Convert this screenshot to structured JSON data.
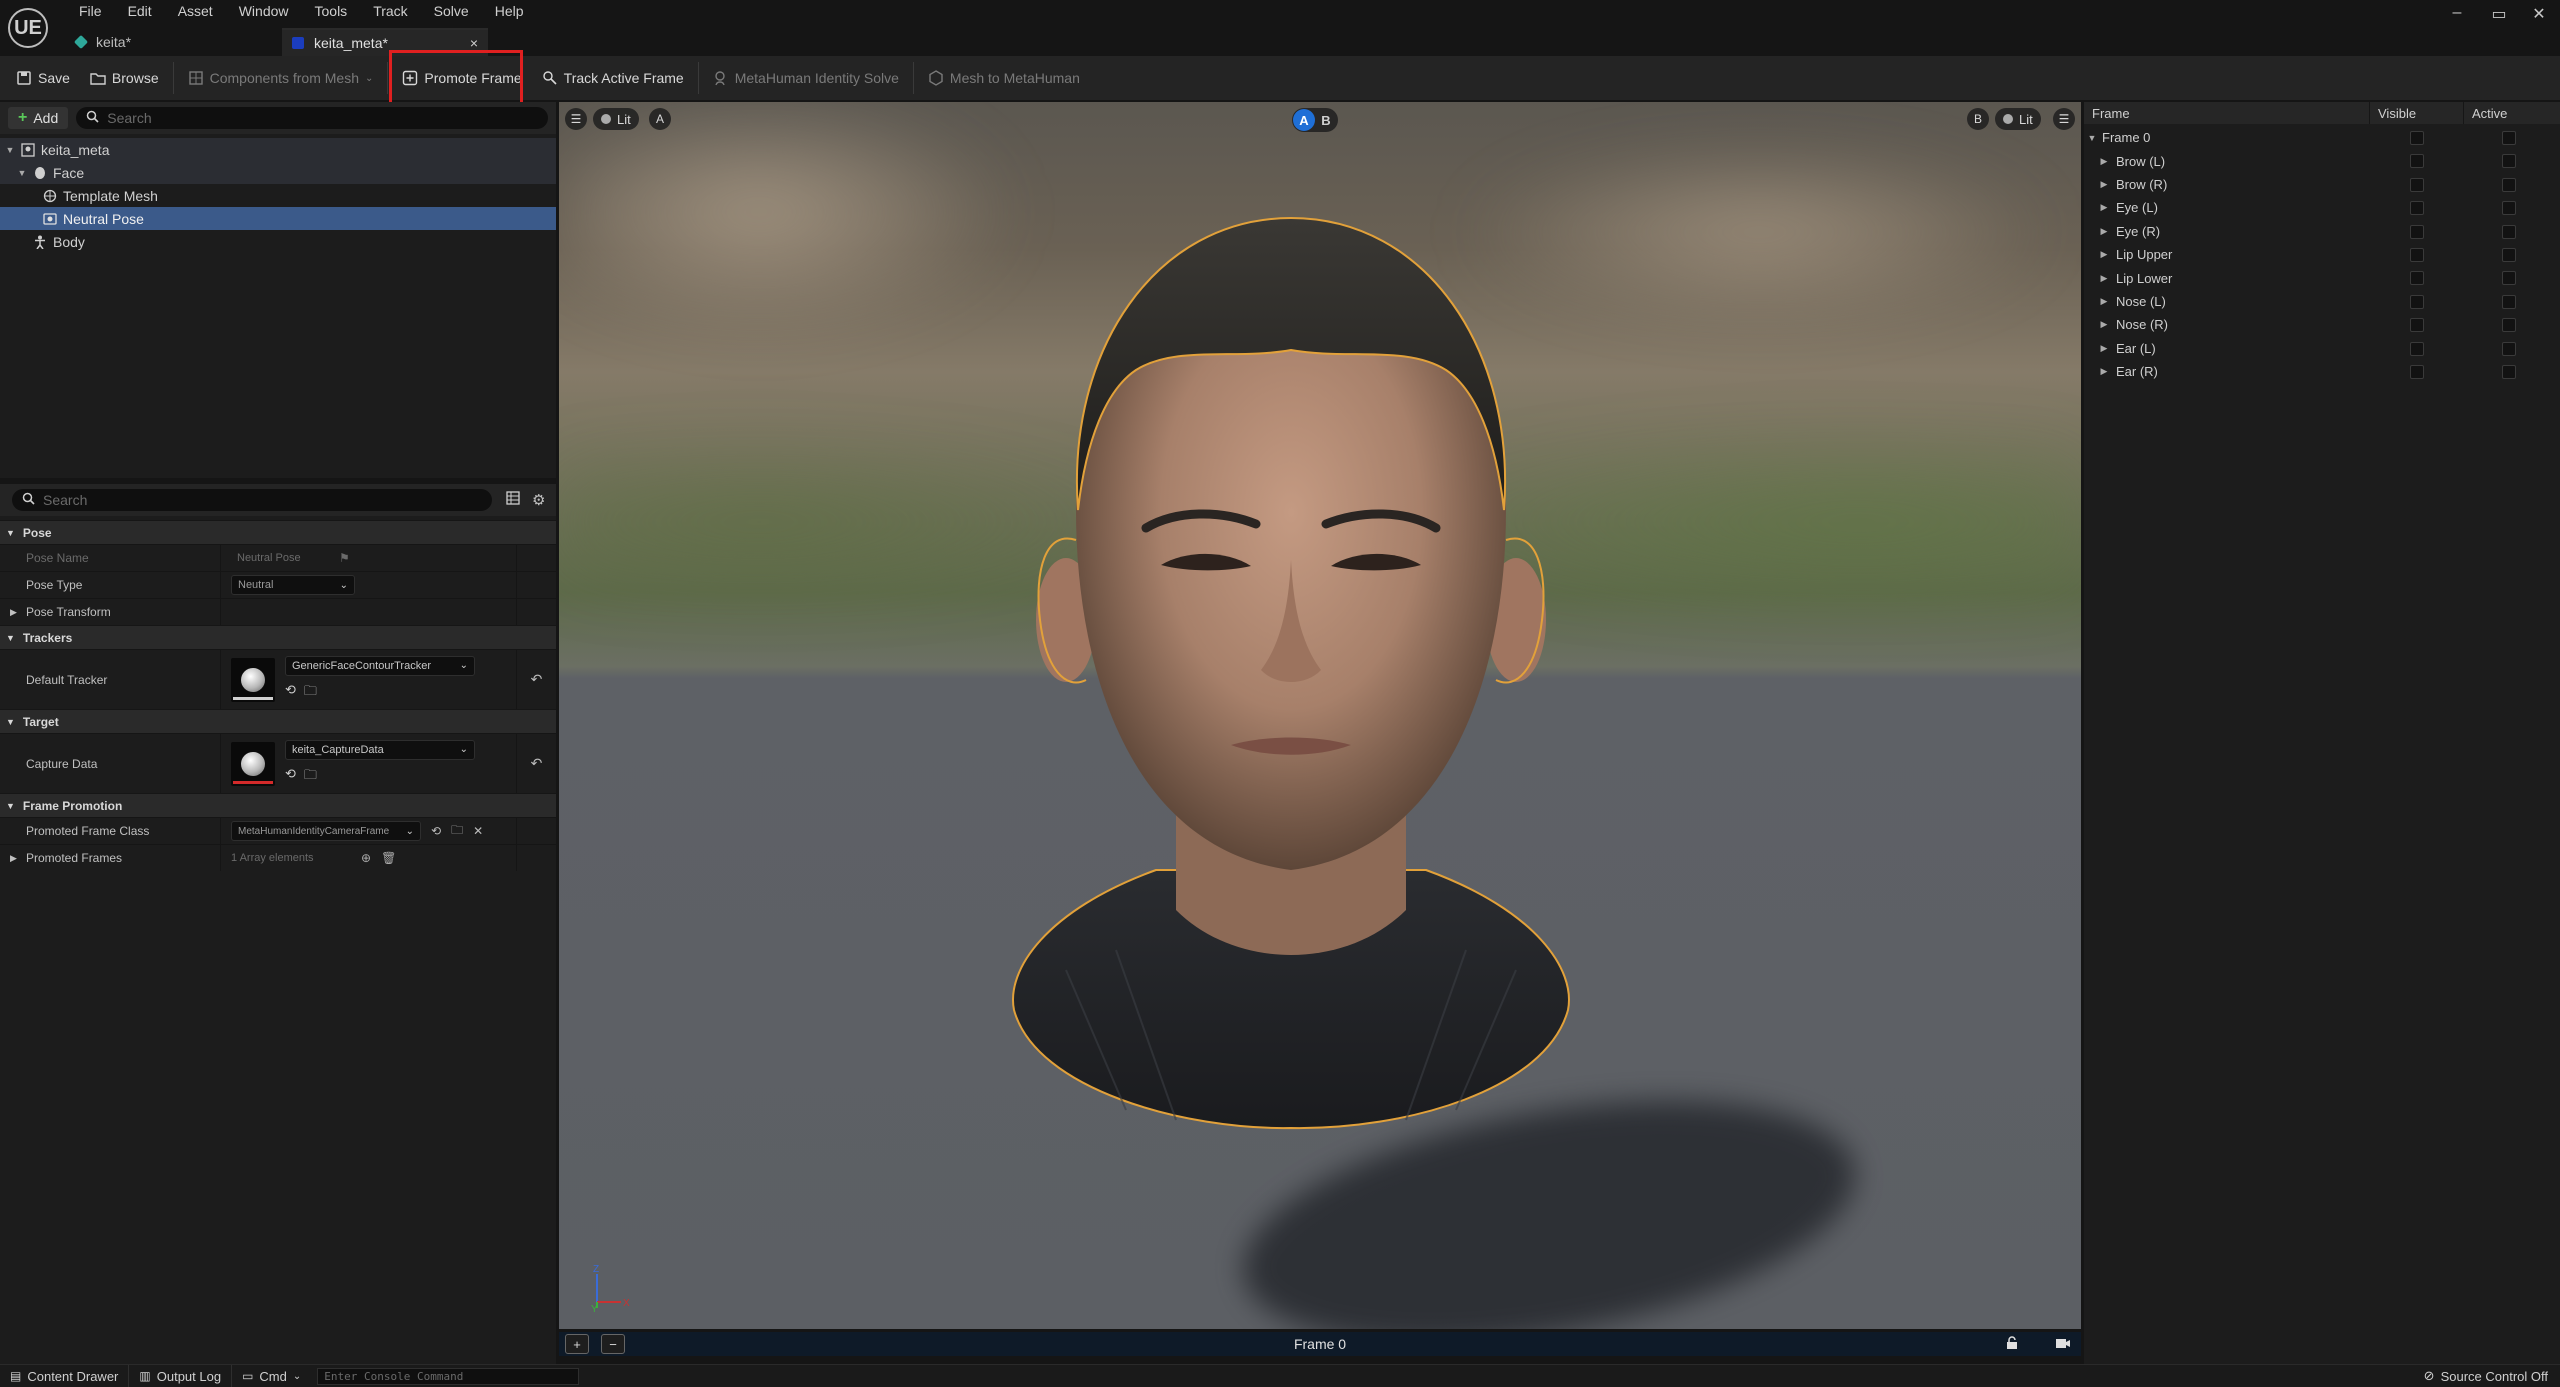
{
  "app": {
    "logo": "UE",
    "menu": [
      "File",
      "Edit",
      "Asset",
      "Window",
      "Tools",
      "Track",
      "Solve",
      "Help"
    ],
    "tabs": [
      {
        "label": "keita*",
        "icon": "mesh-icon",
        "color": "#2ea89a"
      },
      {
        "label": "keita_meta*",
        "icon": "identity-icon",
        "color": "#1b3dbd",
        "close": "×"
      }
    ],
    "window_controls": [
      "–",
      "▭",
      "✕"
    ]
  },
  "toolbar": {
    "save": "Save",
    "browse": "Browse",
    "components_from_mesh": "Components from Mesh",
    "promote_frame": "Promote Frame",
    "track_active_frame": "Track Active Frame",
    "identity_solve": "MetaHuman Identity Solve",
    "mesh_to_metahuman": "Mesh to MetaHuman"
  },
  "outliner": {
    "add_label": "Add",
    "search_placeholder": "Search",
    "items": [
      {
        "label": "keita_meta",
        "icon": "identity-icon"
      },
      {
        "label": "Face",
        "icon": "face-icon"
      },
      {
        "label": "Template Mesh",
        "icon": "mesh-icon"
      },
      {
        "label": "Neutral Pose",
        "icon": "pose-icon"
      },
      {
        "label": "Body",
        "icon": "body-icon"
      }
    ]
  },
  "details": {
    "search_placeholder": "Search",
    "categories": {
      "pose": "Pose",
      "trackers": "Trackers",
      "target": "Target",
      "frame_promotion": "Frame Promotion"
    },
    "props": {
      "pose_name": {
        "label": "Pose Name",
        "value": "Neutral Pose"
      },
      "pose_type": {
        "label": "Pose Type",
        "value": "Neutral"
      },
      "pose_transform": {
        "label": "Pose Transform"
      },
      "default_tracker": {
        "label": "Default Tracker",
        "value": "GenericFaceContourTracker"
      },
      "capture_data": {
        "label": "Capture Data",
        "value": "keita_CaptureData"
      },
      "promoted_frame_class": {
        "label": "Promoted Frame Class",
        "value": "MetaHumanIdentityCameraFrame"
      },
      "promoted_frames": {
        "label": "Promoted Frames",
        "value": "1 Array elements"
      }
    }
  },
  "viewport": {
    "left_lit": "Lit",
    "left_a": "A",
    "toggle_a": "A",
    "toggle_b": "B",
    "right_b": "B",
    "right_lit": "Lit",
    "axis_z": "Z",
    "axis_y": "Y",
    "axis_x": "X"
  },
  "timeline": {
    "frame_label": "Frame 0"
  },
  "frame_panel": {
    "columns": [
      "Frame",
      "Visible",
      "Active"
    ],
    "root": "Frame 0",
    "children": [
      "Brow (L)",
      "Brow (R)",
      "Eye (L)",
      "Eye (R)",
      "Lip Upper",
      "Lip Lower",
      "Nose (L)",
      "Nose (R)",
      "Ear (L)",
      "Ear (R)"
    ]
  },
  "statusbar": {
    "content_drawer": "Content Drawer",
    "output_log": "Output Log",
    "cmd": "Cmd",
    "console_placeholder": "Enter Console Command",
    "source_control": "Source Control Off"
  }
}
